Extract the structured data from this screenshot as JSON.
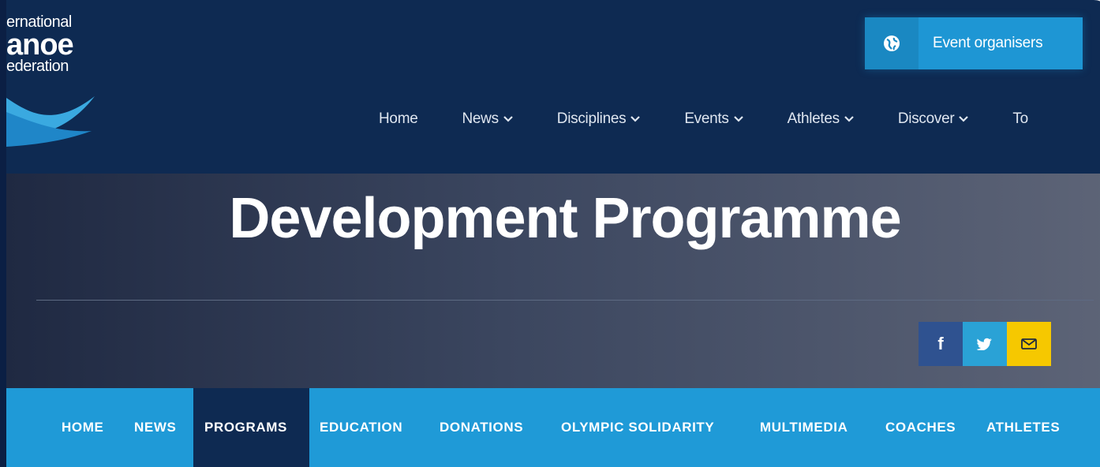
{
  "logo": {
    "line1": "ernational",
    "line2": "anoe",
    "line3": "ederation"
  },
  "event_button": {
    "label": "Event organisers",
    "icon": "globe-icon"
  },
  "main_nav": [
    {
      "label": "Home",
      "has_dropdown": false
    },
    {
      "label": "News",
      "has_dropdown": true
    },
    {
      "label": "Disciplines",
      "has_dropdown": true
    },
    {
      "label": "Events",
      "has_dropdown": true
    },
    {
      "label": "Athletes",
      "has_dropdown": true
    },
    {
      "label": "Discover",
      "has_dropdown": true
    },
    {
      "label": "To",
      "has_dropdown": false
    }
  ],
  "hero": {
    "title": "Development Programme"
  },
  "share": [
    {
      "label": "f",
      "icon": "facebook-icon",
      "color": "#2f5290"
    },
    {
      "label": "",
      "icon": "twitter-icon",
      "color": "#2aa2d6"
    },
    {
      "label": "",
      "icon": "mail-icon",
      "color": "#f6c800"
    }
  ],
  "sub_nav": [
    {
      "label": "HOME",
      "active": false
    },
    {
      "label": "NEWS",
      "active": false
    },
    {
      "label": "PROGRAMS",
      "active": true
    },
    {
      "label": "EDUCATION",
      "active": false
    },
    {
      "label": "DONATIONS",
      "active": false
    },
    {
      "label": "OLYMPIC SOLIDARITY",
      "active": false
    },
    {
      "label": "MULTIMEDIA",
      "active": false
    },
    {
      "label": "COACHES",
      "active": false
    },
    {
      "label": "ATHLETES",
      "active": false
    }
  ],
  "colors": {
    "header_bg": "#0e2a52",
    "accent_blue": "#1f9ad7",
    "active_tab": "#0e2a52",
    "mail_yellow": "#f6c800"
  }
}
